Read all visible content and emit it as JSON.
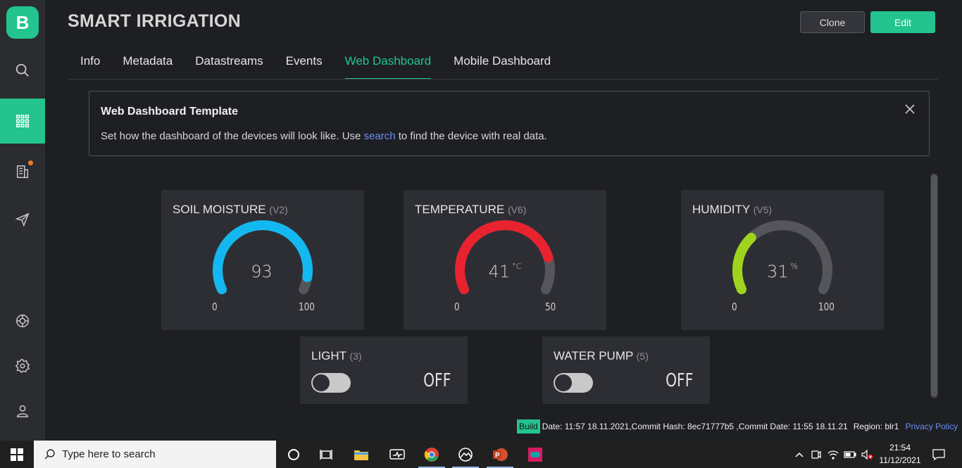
{
  "app": {
    "title": "SMART IRRIGATION",
    "accent_color": "#23c48e",
    "buttons": {
      "clone": "Clone",
      "edit": "Edit"
    }
  },
  "sidebar": {
    "logo": "B",
    "items": [
      {
        "icon": "search-icon"
      },
      {
        "icon": "grid-icon",
        "active": true
      },
      {
        "icon": "building-icon",
        "badge": true
      },
      {
        "icon": "send-icon"
      },
      {
        "icon": "lifebuoy-icon"
      },
      {
        "icon": "gear-icon"
      },
      {
        "icon": "user-icon"
      }
    ]
  },
  "tabs": [
    {
      "label": "Info"
    },
    {
      "label": "Metadata"
    },
    {
      "label": "Datastreams"
    },
    {
      "label": "Events"
    },
    {
      "label": "Web Dashboard",
      "active": true
    },
    {
      "label": "Mobile Dashboard"
    }
  ],
  "notice": {
    "title": "Web Dashboard Template",
    "text_before": "Set how the dashboard of the devices will look like. Use ",
    "link": "search",
    "text_after": " to find the device with real data."
  },
  "widgets": {
    "soil": {
      "title": "SOIL MOISTURE",
      "pin": "(V2)",
      "value": "93",
      "value_num": 93,
      "unit": "",
      "min": "0",
      "max": "100",
      "min_num": 0,
      "max_num": 100,
      "color": "#14b8f0"
    },
    "temp": {
      "title": "TEMPERATURE",
      "pin": "(V6)",
      "value": "41",
      "value_num": 41,
      "unit": "°C",
      "min": "0",
      "max": "50",
      "min_num": 0,
      "max_num": 50,
      "color": "#e8232f"
    },
    "hum": {
      "title": "HUMIDITY",
      "pin": "(V5)",
      "value": "31",
      "value_num": 31,
      "unit": "%",
      "min": "0",
      "max": "100",
      "min_num": 0,
      "max_num": 100,
      "color": "#9fd41e"
    },
    "light": {
      "title": "LIGHT",
      "pin": "(3)",
      "state": "OFF"
    },
    "pump": {
      "title": "WATER PUMP",
      "pin": "(5)",
      "state": "OFF"
    }
  },
  "footer": {
    "build_tag": "Build",
    "build_info": "Date: 11:57 18.11.2021,Commit Hash: 8ec71777b5 ,Commit Date: 11:55 18.11.21",
    "region": "Region: blr1",
    "privacy": "Privacy Policy"
  },
  "taskbar": {
    "search_placeholder": "Type here to search",
    "time": "21:54",
    "date": "11/12/2021"
  }
}
